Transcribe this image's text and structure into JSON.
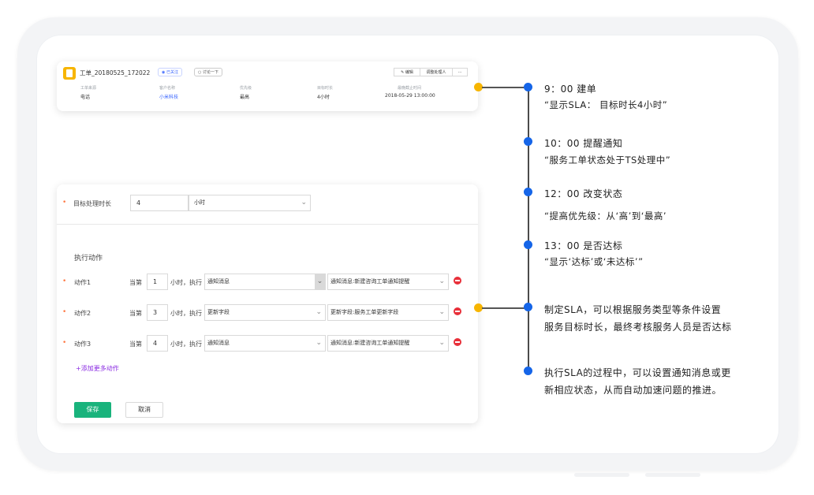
{
  "ticket": {
    "title": "工单_20180525_172022",
    "tag_followed": "已关注",
    "tag_discuss": "讨论一下",
    "btn_edit": "编辑",
    "btn_transfer": "调整处理人",
    "btn_more": "···",
    "fields": [
      {
        "label": "工单来源",
        "value": "电话"
      },
      {
        "label": "客户名称",
        "value": "小米科技"
      },
      {
        "label": "优先级",
        "value": "最高"
      },
      {
        "label": "目标时长",
        "value": "4小时"
      },
      {
        "label": "最晚截止时间",
        "value": "2018-05-29 13:00:00"
      }
    ]
  },
  "form": {
    "target_label": "目标处理时长",
    "target_value": "4",
    "target_unit": "小时",
    "section_title": "执行动作",
    "actions": [
      {
        "label": "动作1",
        "prefix": "当第",
        "num": "1",
        "mid": "小时，执行",
        "type": "通知消息",
        "detail": "通知消息:新建咨询工单通知提醒"
      },
      {
        "label": "动作2",
        "prefix": "当第",
        "num": "3",
        "mid": "小时，执行",
        "type": "更新字段",
        "detail": "更新字段:服务工单更新字段"
      },
      {
        "label": "动作3",
        "prefix": "当第",
        "num": "4",
        "mid": "小时，执行",
        "type": "通知消息",
        "detail": "通知消息:新建咨询工单通知提醒"
      }
    ],
    "add_more": "+添加更多动作",
    "save": "保存",
    "cancel": "取消"
  },
  "timeline": [
    {
      "title": "9：00  建单",
      "sub": "“显示SLA：  目标时长4小时”"
    },
    {
      "title": "10：00  提醒通知",
      "sub": "“服务工单状态处于TS处理中”"
    },
    {
      "title": "12：00  改变状态",
      "sub": "“提高优先级：从‘高’到‘最高’"
    },
    {
      "title": "13：00  是否达标",
      "sub": "“显示‘达标’或‘未达标’”"
    },
    {
      "title": "制定SLA，可以根据服务类型等条件设置",
      "sub": "服务目标时长，最终考核服务人员是否达标"
    },
    {
      "title": "执行SLA的过程中，可以设置通知消息或更",
      "sub": "新相应状态，从而自动加速问题的推进。"
    }
  ],
  "colors": {
    "timeline_dot": "#1565e8",
    "connector_dot": "#f7b500",
    "primary": "#19b37c",
    "danger": "#e8303a"
  }
}
